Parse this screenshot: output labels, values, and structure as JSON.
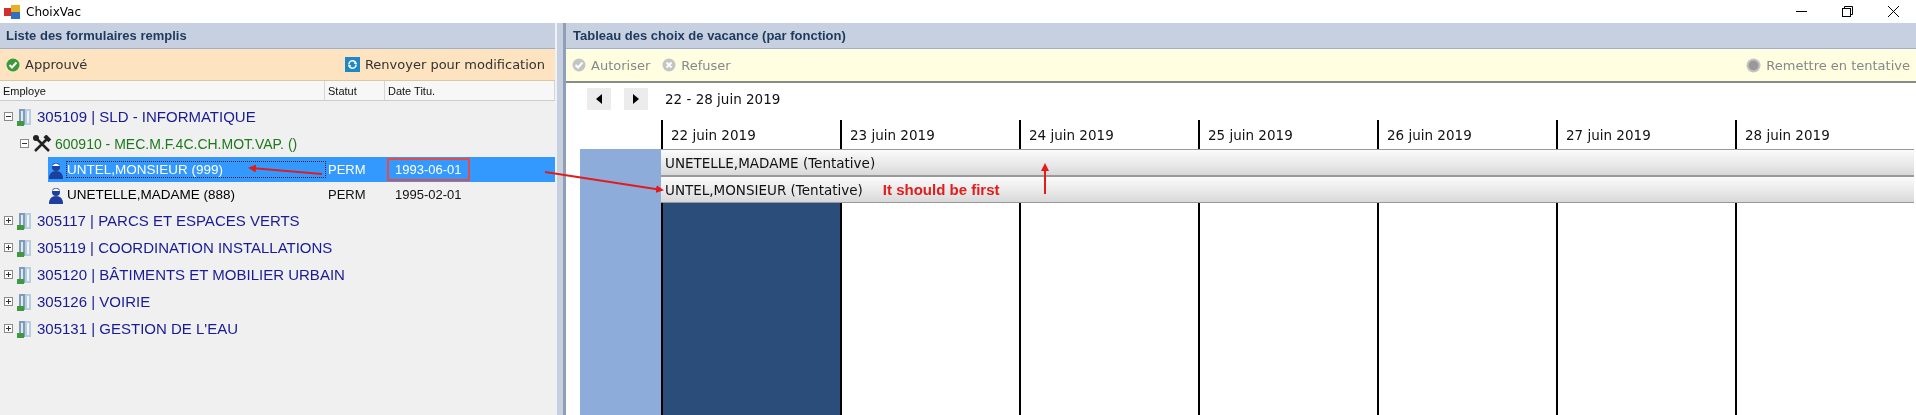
{
  "window": {
    "title": "ChoixVac"
  },
  "left_panel": {
    "title": "Liste des formulaires remplis",
    "toolbar": [
      {
        "label": "Approuvé",
        "kind": "approve"
      },
      {
        "label": "Renvoyer pour modification",
        "kind": "resend"
      }
    ],
    "columns": [
      "Employe",
      "Statut",
      "Date Titu."
    ],
    "tree": [
      {
        "label": "305109 | SLD - INFORMATIQUE",
        "kind": "department",
        "expanded": true,
        "children": [
          {
            "label": "600910 - MEC.M.F.4C.CH.MOT.VAP. ()",
            "kind": "function",
            "expanded": true,
            "children": [
              {
                "label": "UNTEL,MONSIEUR (999)",
                "kind": "employee",
                "status": "PERM",
                "date": "1993-06-01",
                "selected": true,
                "marked": true
              },
              {
                "label": "UNETELLE,MADAME (888)",
                "kind": "employee",
                "status": "PERM",
                "date": "1995-02-01",
                "selected": false,
                "marked": false
              }
            ]
          }
        ]
      },
      {
        "label": "305117 | PARCS ET ESPACES VERTS",
        "kind": "department",
        "expanded": false
      },
      {
        "label": "305119 | COORDINATION INSTALLATIONS",
        "kind": "department",
        "expanded": false
      },
      {
        "label": "305120 | BÂTIMENTS ET MOBILIER URBAIN",
        "kind": "department",
        "expanded": false
      },
      {
        "label": "305126 | VOIRIE",
        "kind": "department",
        "expanded": false
      },
      {
        "label": "305131 | GESTION DE L'EAU",
        "kind": "department",
        "expanded": false
      }
    ]
  },
  "right_panel": {
    "title": "Tableau des choix de vacance (par fonction)",
    "toolbar": [
      {
        "label": "Autoriser",
        "kind": "check",
        "disabled": true
      },
      {
        "label": "Refuser",
        "kind": "cross",
        "disabled": true
      },
      {
        "label": "Remettre en tentative",
        "kind": "dot",
        "disabled": true
      }
    ],
    "range": "22 - 28 juin 2019",
    "days": [
      {
        "label": "22 juin 2019",
        "selected": true
      },
      {
        "label": "23 juin 2019",
        "selected": false
      },
      {
        "label": "24 juin 2019",
        "selected": false
      },
      {
        "label": "25 juin 2019",
        "selected": false
      },
      {
        "label": "26 juin 2019",
        "selected": false
      },
      {
        "label": "27 juin 2019",
        "selected": false
      },
      {
        "label": "28 juin 2019",
        "selected": false
      }
    ],
    "bookings": [
      {
        "label": "UNETELLE,MADAME (Tentative)"
      },
      {
        "label": "UNTEL,MONSIEUR (Tentative)",
        "note": "It should be first"
      }
    ]
  }
}
